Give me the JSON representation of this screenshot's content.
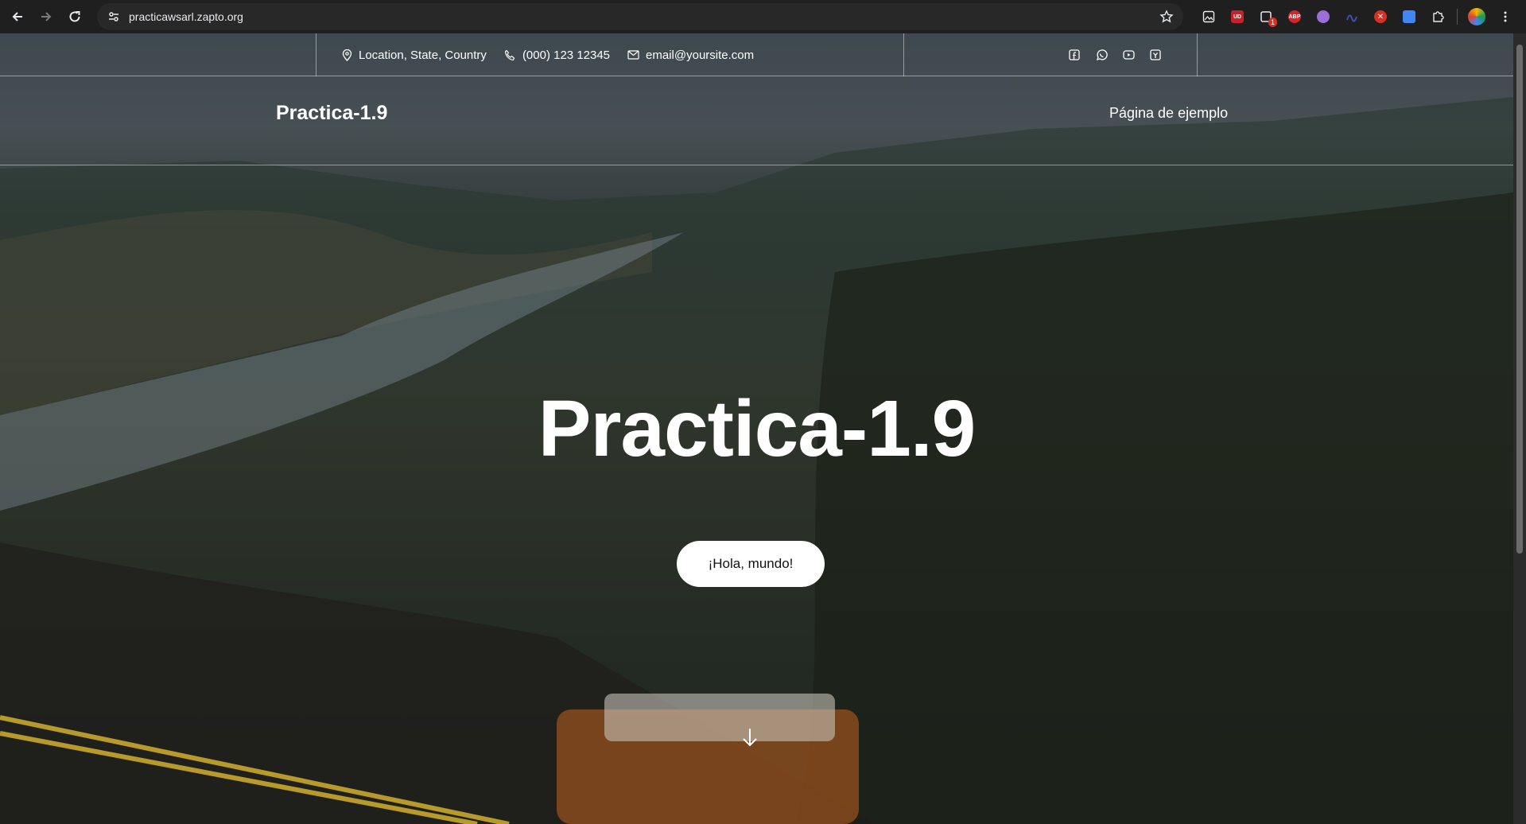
{
  "browser": {
    "url": "practicawsarl.zapto.org",
    "extensions": [
      {
        "icon": "image-icon",
        "label": ""
      },
      {
        "icon": "ublock-icon",
        "label": "UD",
        "color": "#c4222a"
      },
      {
        "icon": "clipboard-icon",
        "label": "",
        "badge": "1"
      },
      {
        "icon": "adblock-plus-icon",
        "label": "ABP",
        "color": "#d6242a"
      },
      {
        "icon": "purple-circle-icon",
        "label": "",
        "color": "#9b6fd6"
      },
      {
        "icon": "blue-glyph-icon",
        "label": "",
        "color": "#3a4fb8"
      },
      {
        "icon": "red-x-icon",
        "label": "",
        "color": "#d93025"
      },
      {
        "icon": "blue-square-icon",
        "label": "",
        "color": "#4285f4"
      },
      {
        "icon": "puzzle-icon",
        "label": ""
      }
    ]
  },
  "topbar": {
    "location": "Location, State, Country",
    "phone": "(000) 123 12345",
    "email": "email@yoursite.com",
    "social": [
      "facebook-icon",
      "whatsapp-icon",
      "youtube-icon",
      "tripadvisor-icon"
    ]
  },
  "header": {
    "site_title": "Practica-1.9",
    "menu_item": "Página de ejemplo"
  },
  "hero": {
    "title": "Practica-1.9",
    "button_label": "¡Hola, mundo!"
  },
  "colors": {
    "chrome_bg": "#1f1f1f",
    "omnibox_bg": "#282828",
    "button_bg": "#ffffff",
    "text": "#ffffff"
  }
}
